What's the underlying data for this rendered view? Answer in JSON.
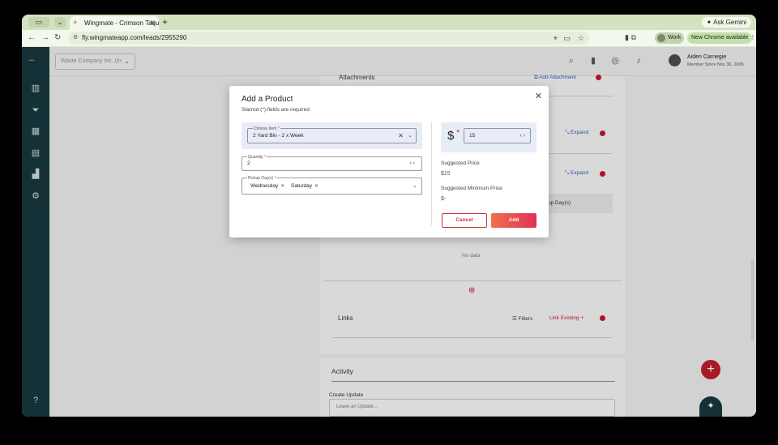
{
  "browser": {
    "tab_title": "Wingmate - Crimson Taqueria",
    "new_tab": "+",
    "ask_gemini": "Ask Gemini",
    "url": "fly.wingmateapp.com/leads/2955290",
    "profile_label": "Work",
    "new_chrome_label": "New Chrome available"
  },
  "header": {
    "company_placeholder": "Waste Company Inc. (In",
    "user_name": "Aiden Carnegie",
    "user_since": "Member Since Nov 30, 2006"
  },
  "background": {
    "attachments_title": "Attachments",
    "add_attachment": "Add Attachment",
    "expand_1": "Expand",
    "expand_2": "Expand",
    "pickup_days_col": "up Day(s)",
    "no_data": "No data",
    "links_title": "Links",
    "filters": "Filters",
    "link_existing": "Link Existing",
    "activity_title": "Activity",
    "create_update": "Create Update",
    "update_placeholder": "Leave an Update..."
  },
  "modal": {
    "title": "Add a Product",
    "subtitle": "Starred (*) fields are required",
    "choose_item_label": "Choose Item",
    "choose_item_value": "2 Yard Bin - 2 x Week",
    "quantity_label": "Quantity",
    "quantity_value": "2",
    "pickup_days_label": "Pickup Day(s)",
    "pickup_days": [
      "Wednesday",
      "Saturday"
    ],
    "currency_symbol": "$",
    "price_value": "15",
    "suggested_price_label": "Suggested Price",
    "suggested_price_value": "$15",
    "suggested_min_label": "Suggested Minimum Price",
    "suggested_min_value": "$-",
    "cancel_label": "Cancel",
    "add_label": "Add"
  }
}
